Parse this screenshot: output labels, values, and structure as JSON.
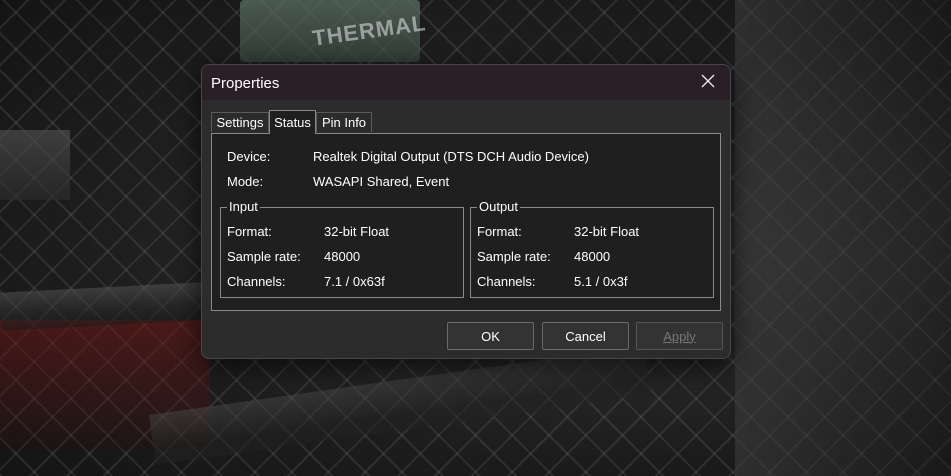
{
  "dialog": {
    "title": "Properties",
    "tabs": [
      {
        "label": "Settings",
        "active": false
      },
      {
        "label": "Status",
        "active": true
      },
      {
        "label": "Pin Info",
        "active": false
      }
    ],
    "device": {
      "label": "Device:",
      "value": "Realtek Digital Output (DTS DCH Audio Device)"
    },
    "mode": {
      "label": "Mode:",
      "value": "WASAPI Shared, Event"
    },
    "input": {
      "title": "Input",
      "format": {
        "label": "Format:",
        "value": "32-bit Float"
      },
      "sample_rate": {
        "label": "Sample rate:",
        "value": "48000"
      },
      "channels": {
        "label": "Channels:",
        "value": "7.1 / 0x63f"
      }
    },
    "output": {
      "title": "Output",
      "format": {
        "label": "Format:",
        "value": "32-bit Float"
      },
      "sample_rate": {
        "label": "Sample rate:",
        "value": "48000"
      },
      "channels": {
        "label": "Channels:",
        "value": "5.1 / 0x3f"
      }
    },
    "buttons": {
      "ok": "OK",
      "cancel": "Cancel",
      "apply": "Apply"
    },
    "icons": {
      "close": "close-icon"
    }
  },
  "background": {
    "sign_text": "THERMAL"
  }
}
